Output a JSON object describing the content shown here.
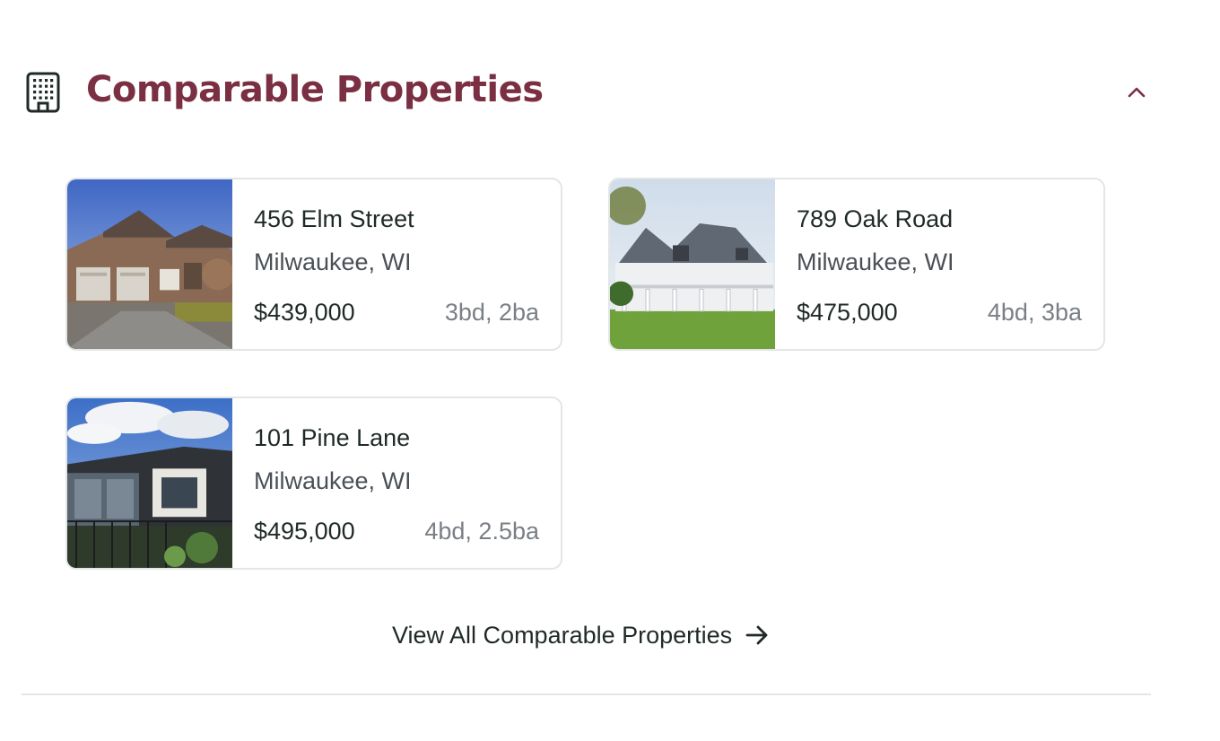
{
  "section": {
    "title": "Comparable Properties",
    "icon": "building-icon",
    "collapse_icon": "chevron-up-icon",
    "accent_color": "#7b2f42"
  },
  "properties": [
    {
      "address": "456 Elm Street",
      "city": "Milwaukee, WI",
      "price": "$439,000",
      "beds_baths": "3bd, 2ba",
      "photo": "stone-house-photo"
    },
    {
      "address": "789 Oak Road",
      "city": "Milwaukee, WI",
      "price": "$475,000",
      "beds_baths": "4bd, 3ba",
      "photo": "white-porch-house-photo"
    },
    {
      "address": "101 Pine Lane",
      "city": "Milwaukee, WI",
      "price": "$495,000",
      "beds_baths": "4bd, 2.5ba",
      "photo": "modern-house-photo"
    }
  ],
  "footer": {
    "view_all_label": "View All Comparable Properties",
    "arrow_icon": "arrow-right-icon"
  }
}
